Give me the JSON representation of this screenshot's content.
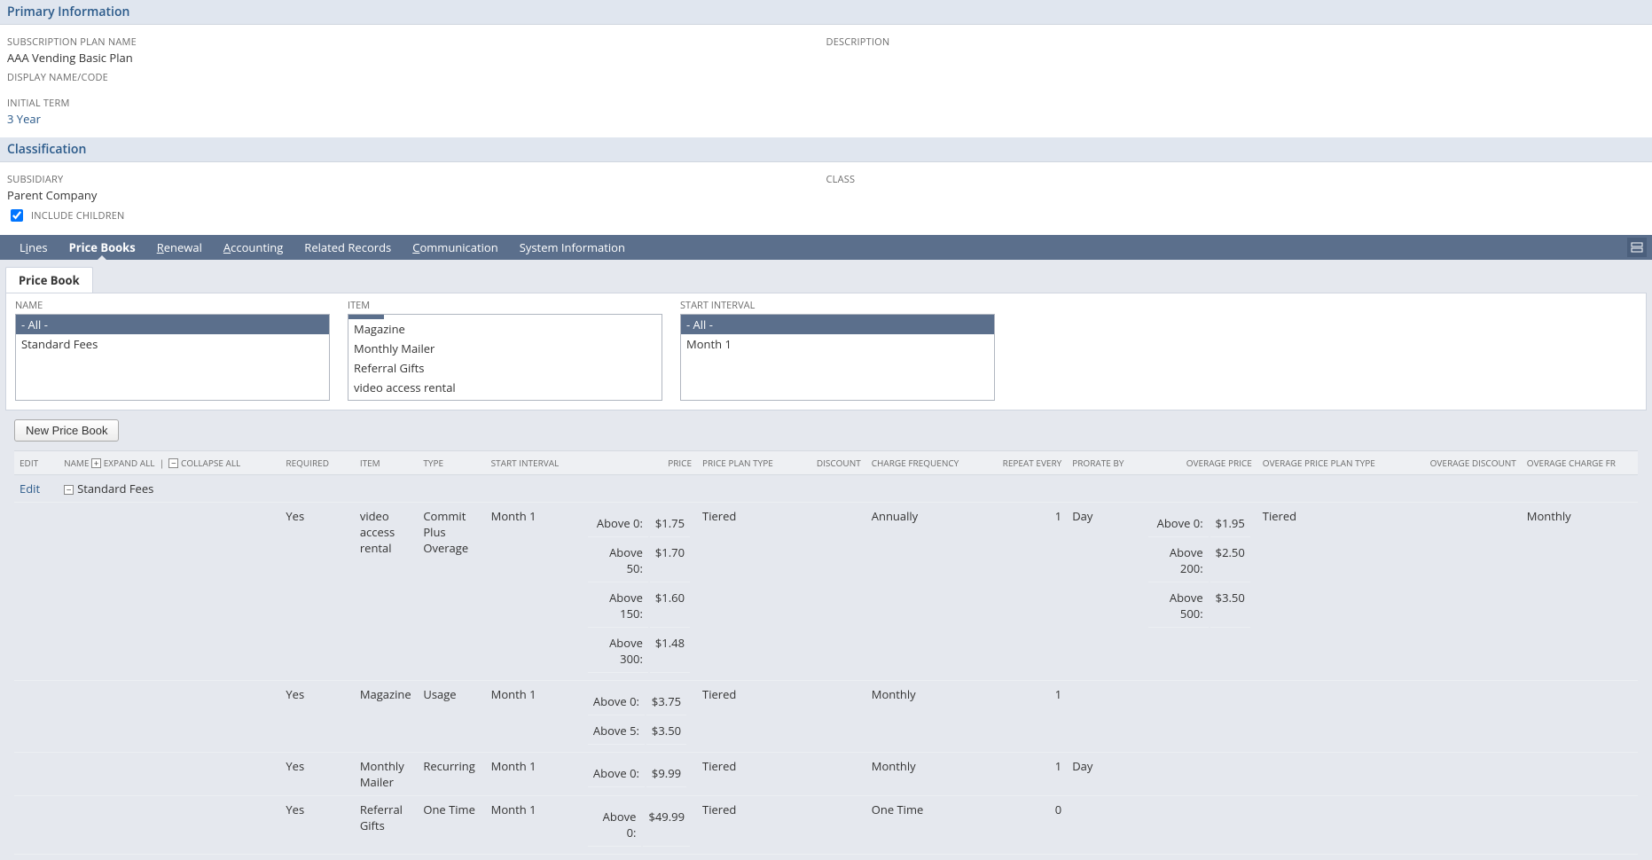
{
  "primary_info": {
    "header": "Primary Information",
    "plan_name_label": "SUBSCRIPTION PLAN NAME",
    "plan_name": "AAA Vending Basic Plan",
    "display_name_label": "DISPLAY NAME/CODE",
    "display_name": "",
    "initial_term_label": "INITIAL TERM",
    "initial_term": "3 Year",
    "description_label": "DESCRIPTION",
    "description": ""
  },
  "classification": {
    "header": "Classification",
    "subsidiary_label": "SUBSIDIARY",
    "subsidiary": "Parent Company",
    "include_children_label": "INCLUDE CHILDREN",
    "include_children_checked": true,
    "class_label": "CLASS",
    "class": ""
  },
  "tabs": {
    "lines": "Lines",
    "price_books": "Price Books",
    "renewal": "Renewal",
    "accounting": "Accounting",
    "related_records": "Related Records",
    "communication": "Communication",
    "system_information": "System Information",
    "active": "price_books"
  },
  "subtab": {
    "price_book": "Price Book"
  },
  "filters": {
    "name_label": "NAME",
    "name_options": [
      "- All -",
      "Standard Fees"
    ],
    "name_selected": "- All -",
    "item_label": "ITEM",
    "item_options": [
      "Magazine",
      "Monthly Mailer",
      "Referral Gifts",
      "video access rental"
    ],
    "start_interval_label": "START INTERVAL",
    "start_interval_options": [
      "- All -",
      "Month 1"
    ],
    "start_interval_selected": "- All -"
  },
  "buttons": {
    "new_price_book": "New Price Book"
  },
  "grid": {
    "headers": {
      "edit": "EDIT",
      "name": "NAME",
      "expand_all": "EXPAND ALL",
      "collapse_all": "COLLAPSE ALL",
      "required": "REQUIRED",
      "item": "ITEM",
      "type": "TYPE",
      "start_interval": "START INTERVAL",
      "price": "PRICE",
      "price_plan_type": "PRICE PLAN TYPE",
      "discount": "DISCOUNT",
      "charge_frequency": "CHARGE FREQUENCY",
      "repeat_every": "REPEAT EVERY",
      "prorate_by": "PRORATE BY",
      "overage_price": "OVERAGE PRICE",
      "overage_price_plan_type": "OVERAGE PRICE PLAN TYPE",
      "overage_discount": "OVERAGE DISCOUNT",
      "overage_charge_fr": "OVERAGE CHARGE FR"
    },
    "group": {
      "edit": "Edit",
      "name": "Standard Fees"
    },
    "rows": [
      {
        "required": "Yes",
        "item": "video access rental",
        "type": "Commit Plus Overage",
        "start_interval": "Month 1",
        "price": [
          {
            "label": "Above 0:",
            "value": "$1.75"
          },
          {
            "label": "Above 50:",
            "value": "$1.70"
          },
          {
            "label": "Above 150:",
            "value": "$1.60"
          },
          {
            "label": "Above 300:",
            "value": "$1.48"
          }
        ],
        "price_plan_type": "Tiered",
        "discount": "",
        "charge_frequency": "Annually",
        "repeat_every": "1",
        "prorate_by": "Day",
        "overage_price": [
          {
            "label": "Above 0:",
            "value": "$1.95"
          },
          {
            "label": "Above 200:",
            "value": "$2.50"
          },
          {
            "label": "Above 500:",
            "value": "$3.50"
          }
        ],
        "overage_price_plan_type": "Tiered",
        "overage_discount": "",
        "overage_charge_fr": "Monthly"
      },
      {
        "required": "Yes",
        "item": "Magazine",
        "type": "Usage",
        "start_interval": "Month 1",
        "price": [
          {
            "label": "Above 0:",
            "value": "$3.75"
          },
          {
            "label": "Above 5:",
            "value": "$3.50"
          }
        ],
        "price_plan_type": "Tiered",
        "discount": "",
        "charge_frequency": "Monthly",
        "repeat_every": "1",
        "prorate_by": "",
        "overage_price": [],
        "overage_price_plan_type": "",
        "overage_discount": "",
        "overage_charge_fr": ""
      },
      {
        "required": "Yes",
        "item": "Monthly Mailer",
        "type": "Recurring",
        "start_interval": "Month 1",
        "price": [
          {
            "label": "Above 0:",
            "value": "$9.99"
          }
        ],
        "price_plan_type": "Tiered",
        "discount": "",
        "charge_frequency": "Monthly",
        "repeat_every": "1",
        "prorate_by": "Day",
        "overage_price": [],
        "overage_price_plan_type": "",
        "overage_discount": "",
        "overage_charge_fr": ""
      },
      {
        "required": "Yes",
        "item": "Referral Gifts",
        "type": "One Time",
        "start_interval": "Month 1",
        "price": [
          {
            "label": "Above 0:",
            "value": "$49.99"
          }
        ],
        "price_plan_type": "Tiered",
        "discount": "",
        "charge_frequency": "One Time",
        "repeat_every": "0",
        "prorate_by": "",
        "overage_price": [],
        "overage_price_plan_type": "",
        "overage_discount": "",
        "overage_charge_fr": ""
      }
    ]
  }
}
